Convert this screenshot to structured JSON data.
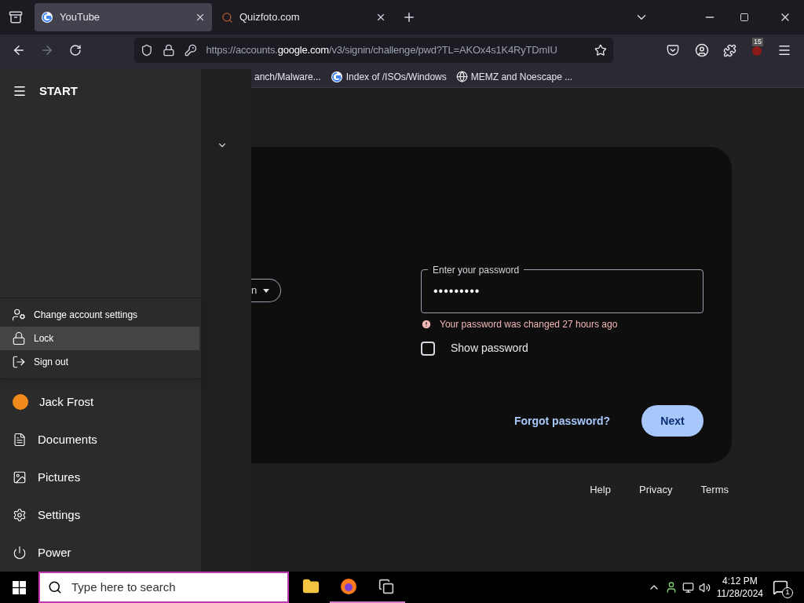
{
  "browser": {
    "tabs": [
      {
        "title": "YouTube",
        "selected": true
      },
      {
        "title": "Quizfoto.com",
        "selected": false
      }
    ],
    "address": {
      "scheme": "https://accounts.",
      "domain": "google.com",
      "path": "/v3/signin/challenge/pwd?TL=AKOx4s1K4RyTDmIU"
    },
    "extension_badge": "15",
    "bookmarks": [
      "anch/Malware...",
      "Index of /ISOs/Windows",
      "MEMZ and Noescape ..."
    ]
  },
  "page": {
    "chip": "n",
    "password_field": {
      "label": "Enter your password",
      "value": "•••••••••"
    },
    "error": "Your password was changed 27 hours ago",
    "show_password": {
      "label": "Show password",
      "checked": false
    },
    "forgot": "Forgot password?",
    "next": "Next",
    "footer": [
      "Help",
      "Privacy",
      "Terms"
    ]
  },
  "start_menu": {
    "title": "START",
    "account_menu": [
      {
        "label": "Change account settings",
        "selected": false
      },
      {
        "label": "Lock",
        "selected": true
      },
      {
        "label": "Sign out",
        "selected": false
      }
    ],
    "items": [
      "Jack Frost",
      "Documents",
      "Pictures",
      "Settings",
      "Power"
    ]
  },
  "taskbar": {
    "search_placeholder": "Type here to search",
    "apps": [
      {
        "active": false
      },
      {
        "active": true
      },
      {
        "active": true
      }
    ],
    "time": "4:12 PM",
    "date": "11/28/2024",
    "notifications": "1"
  }
}
